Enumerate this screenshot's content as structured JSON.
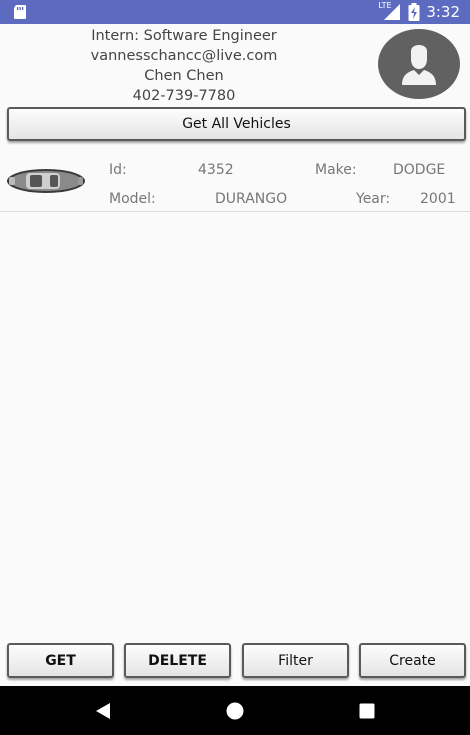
{
  "status_bar": {
    "network": "LTE",
    "time": "3:32"
  },
  "profile": {
    "title": "Intern: Software Engineer",
    "email": "vannesschancc@live.com",
    "name": "Chen Chen",
    "phone": "402-739-7780"
  },
  "actions": {
    "get_all_label": "Get All Vehicles"
  },
  "vehicle": {
    "id_label": "Id:",
    "id_value": "4352",
    "make_label": "Make:",
    "make_value": "DODGE",
    "model_label": "Model:",
    "model_value": "DURANGO",
    "year_label": "Year:",
    "year_value": "2001"
  },
  "bottom_buttons": {
    "get": "GET",
    "delete": "DELETE",
    "filter": "Filter",
    "create": "Create"
  },
  "colors": {
    "status_bar": "#5c6bc0",
    "nav_bar": "#000000",
    "avatar_bg": "#616161"
  }
}
